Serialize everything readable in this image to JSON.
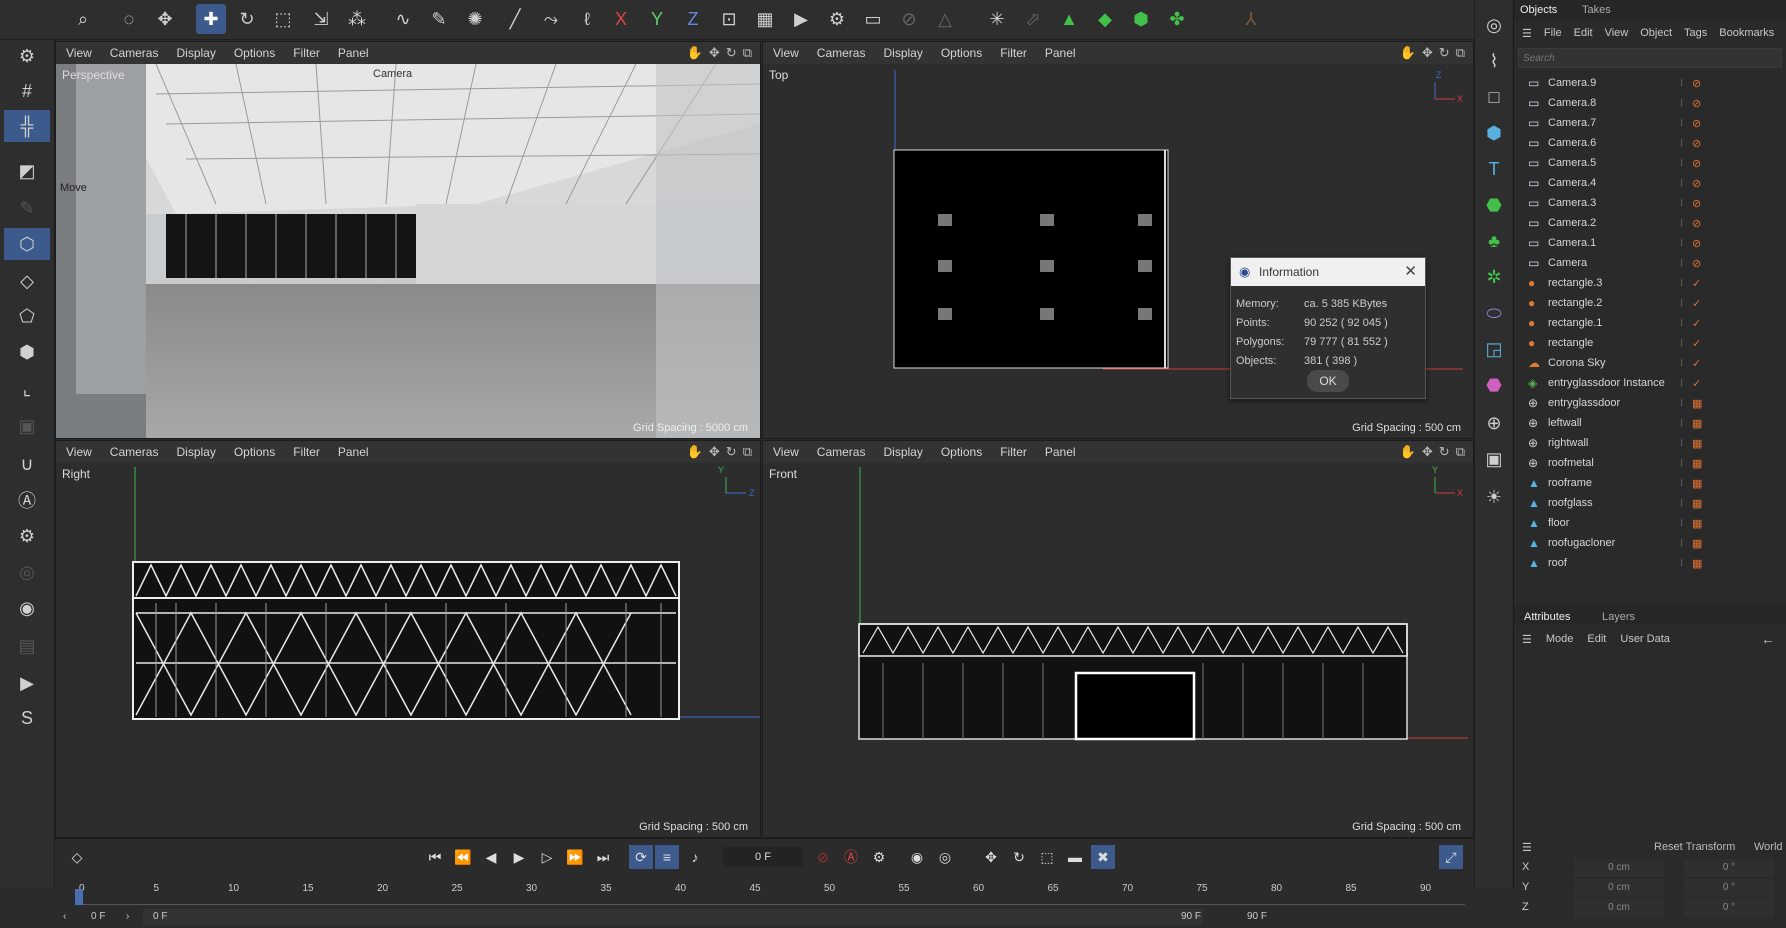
{
  "viewports": {
    "perspective": {
      "name": "Perspective",
      "camera": "Camera",
      "hud": "Move",
      "grid": "Grid Spacing : 5000 cm"
    },
    "top": {
      "name": "Top",
      "grid": "Grid Spacing : 500 cm"
    },
    "right": {
      "name": "Right",
      "grid": "Grid Spacing : 500 cm"
    },
    "front": {
      "name": "Front",
      "grid": "Grid Spacing : 500 cm"
    }
  },
  "vpmenu": [
    "View",
    "Cameras",
    "Display",
    "Options",
    "Filter",
    "Panel"
  ],
  "objects_tabs": [
    "Objects",
    "Takes"
  ],
  "objects_menu": [
    "File",
    "Edit",
    "View",
    "Object",
    "Tags",
    "Bookmarks"
  ],
  "search_placeholder": "Search",
  "objects": [
    "Camera.9",
    "Camera.8",
    "Camera.7",
    "Camera.6",
    "Camera.5",
    "Camera.4",
    "Camera.3",
    "Camera.2",
    "Camera.1",
    "Camera",
    "rectangle.3",
    "rectangle.2",
    "rectangle.1",
    "rectangle",
    "Corona Sky",
    "entryglassdoor Instance",
    "entryglassdoor",
    "leftwall",
    "rightwall",
    "roofmetal",
    "rooframe",
    "roofglass",
    "floor",
    "roofugacloner",
    "roof"
  ],
  "attributes": {
    "tabs": [
      "Attributes",
      "Layers"
    ],
    "menu": [
      "Mode",
      "Edit",
      "User Data"
    ]
  },
  "coords": {
    "reset": "Reset Transform",
    "world": "World",
    "rows": [
      {
        "axis": "X",
        "pos": "0 cm",
        "rot": "0 °"
      },
      {
        "axis": "Y",
        "pos": "0 cm",
        "rot": "0 °"
      },
      {
        "axis": "Z",
        "pos": "0 cm",
        "rot": "0 °"
      }
    ]
  },
  "dialog": {
    "title": "Information",
    "rows": [
      {
        "label": "Memory:",
        "value": "ca. 5 385 KBytes"
      },
      {
        "label": "Points:",
        "value": "90 252 ( 92 045 )"
      },
      {
        "label": "Polygons:",
        "value": "79 777 ( 81 552 )"
      },
      {
        "label": "Objects:",
        "value": "381 ( 398 )"
      }
    ],
    "ok": "OK"
  },
  "timeline": {
    "current_frame": "0 F",
    "ticks": [
      "0",
      "5",
      "10",
      "15",
      "20",
      "25",
      "30",
      "35",
      "40",
      "45",
      "50",
      "55",
      "60",
      "65",
      "70",
      "75",
      "80",
      "85",
      "90"
    ],
    "start": "0 F",
    "start2": "0 F",
    "end": "90 F",
    "end2": "90 F"
  },
  "colors": {
    "accent": "#3c5a8c",
    "x_axis": "#d03a3a",
    "y_axis": "#3ab54a",
    "z_axis": "#3a6ad0"
  }
}
